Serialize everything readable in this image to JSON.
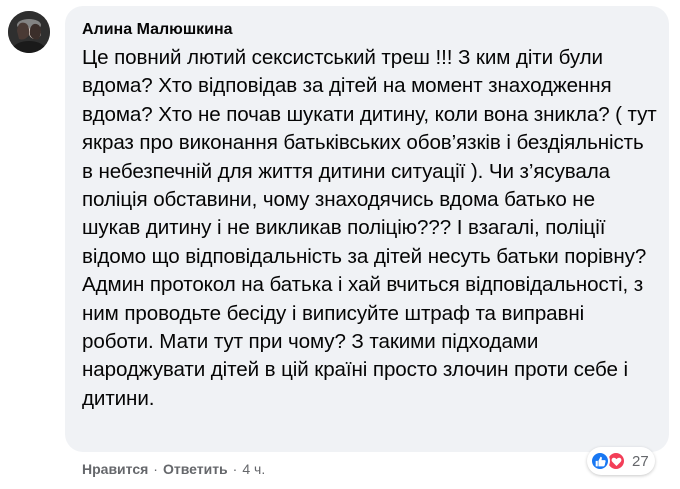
{
  "comment": {
    "author": "Алина Малюшкина",
    "text": "Це повний лютий сексистський треш !!! З ким діти були вдома? Хто відповідав за дітей на момент знаходження вдома? Хто не почав шукати дитину, коли вона зникла? ( тут якраз про виконання батьківських обов’язків і бездіяльність в небезпечній для життя дитини ситуації ). Чи з’ясувала поліція обставини, чому знаходячись вдома батько не шукав дитину і не викликав поліцію??? І взагалі, поліції відомо що відповідальність за дітей несуть батьки порівну? Админ протокол на батька і хай вчиться відповідальності, з ним проводьте бесіду і виписуйте штраф та виправні роботи. Мати тут при чому? З такими підходами народжувати дітей в цій країні просто злочин проти себе і дитини."
  },
  "actions": {
    "like_label": "Нравится",
    "reply_label": "Ответить",
    "separator": "·",
    "time": "4 ч."
  },
  "reactions": {
    "count": "27",
    "icons": [
      "like-icon",
      "love-icon"
    ],
    "like_color": "#1877f2",
    "love_color": "#f33e58"
  },
  "colors": {
    "bubble_background": "#f0f2f5",
    "text": "#050505",
    "secondary_text": "#65676b"
  }
}
